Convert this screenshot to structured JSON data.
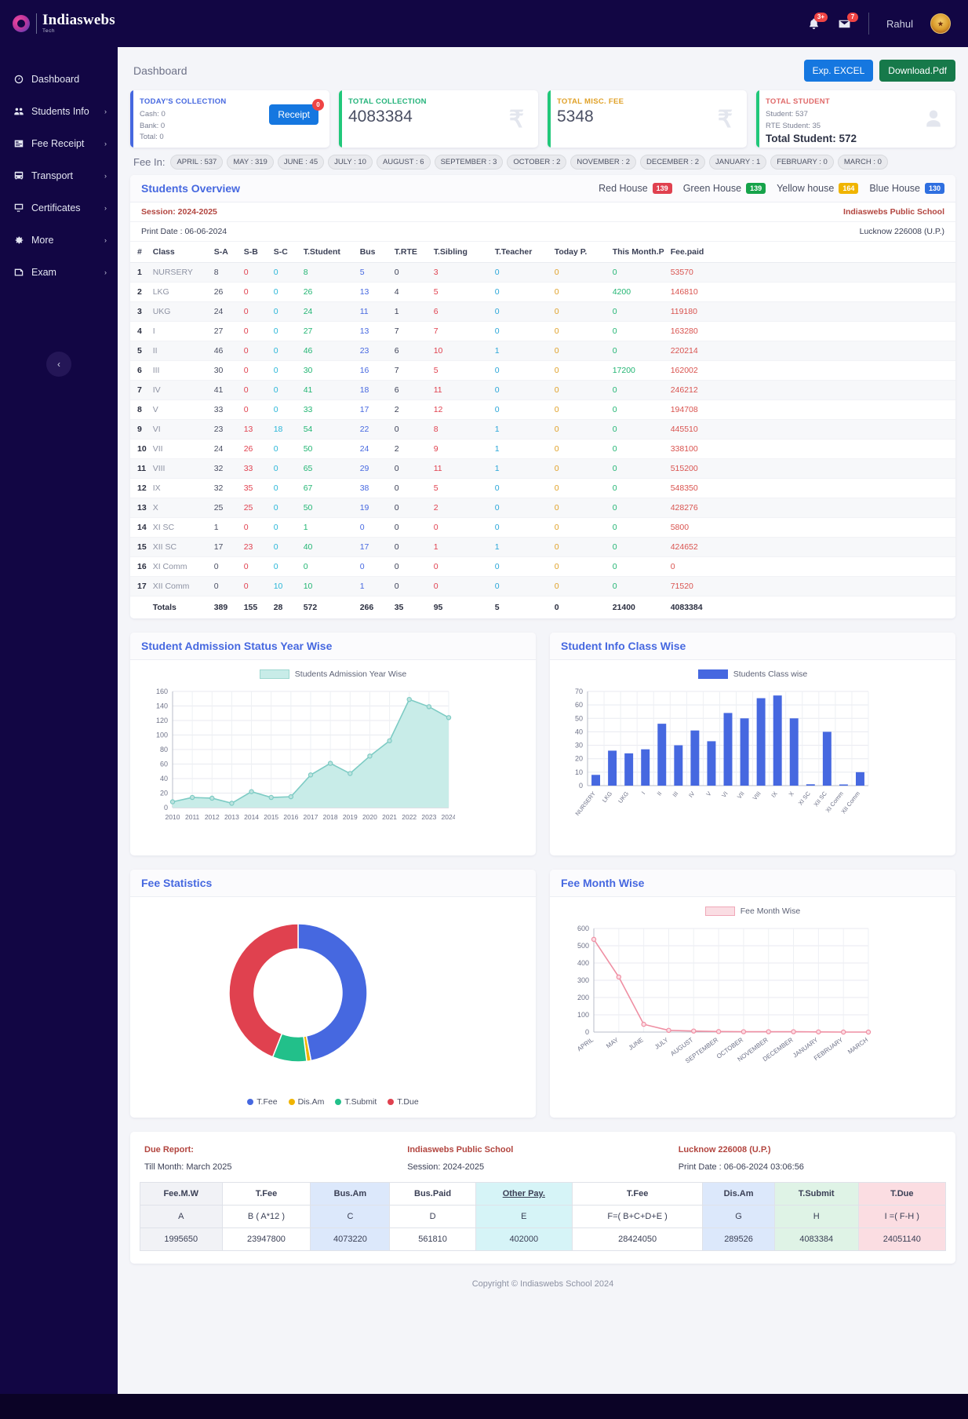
{
  "brand": {
    "name": "Indiaswebs",
    "sub": "Tech"
  },
  "sidebar": {
    "items": [
      {
        "label": "Dashboard",
        "icon": "gauge-icon",
        "chevron": ""
      },
      {
        "label": "Students Info",
        "icon": "users-icon",
        "chevron": "›"
      },
      {
        "label": "Fee Receipt",
        "icon": "receipt-icon",
        "chevron": "›"
      },
      {
        "label": "Transport",
        "icon": "bus-icon",
        "chevron": "›"
      },
      {
        "label": "Certificates",
        "icon": "certificate-icon",
        "chevron": "›"
      },
      {
        "label": "More",
        "icon": "gear-icon",
        "chevron": "›"
      },
      {
        "label": "Exam",
        "icon": "exam-icon",
        "chevron": "›"
      }
    ],
    "collapse_glyph": "‹"
  },
  "header": {
    "notifications_badge": "3+",
    "messages_badge": "7",
    "user_name": "Rahul",
    "avatar_text": "★"
  },
  "page": {
    "title": "Dashboard",
    "export_excel": "Exp. EXCEL",
    "download_pdf": "Download.Pdf"
  },
  "cards": [
    {
      "label": "TODAY'S COLLECTION",
      "lines": [
        "Cash: 0",
        "Bank: 0",
        "Total: 0"
      ],
      "button": "Receipt",
      "button_badge": "0"
    },
    {
      "label": "TOTAL COLLECTION",
      "value": "4083384",
      "icon": "rupee-icon"
    },
    {
      "label": "TOTAL MISC. FEE",
      "value": "5348",
      "icon": "rupee-icon"
    },
    {
      "label": "TOTAL STUDENT",
      "lines": [
        "Student: 537",
        "RTE Student: 35"
      ],
      "total": "Total Student: 572",
      "icon": "user-icon"
    }
  ],
  "fee_in": {
    "label": "Fee In:",
    "months": [
      "APRIL : 537",
      "MAY : 319",
      "JUNE : 45",
      "JULY : 10",
      "AUGUST : 6",
      "SEPTEMBER : 3",
      "OCTOBER : 2",
      "NOVEMBER : 2",
      "DECEMBER : 2",
      "JANUARY : 1",
      "FEBRUARY : 0",
      "MARCH : 0"
    ]
  },
  "overview": {
    "title": "Students Overview",
    "houses": [
      {
        "name": "Red House",
        "count": "139"
      },
      {
        "name": "Green House",
        "count": "139"
      },
      {
        "name": "Yellow house",
        "count": "164"
      },
      {
        "name": "Blue House",
        "count": "130"
      }
    ],
    "session": "Session: 2024-2025",
    "school": "Indiaswebs Public School",
    "print_date": "Print Date : 06-06-2024",
    "location": "Lucknow 226008 (U.P.)",
    "columns": [
      "#",
      "Class",
      "S-A",
      "S-B",
      "S-C",
      "T.Student",
      "Bus",
      "T.RTE",
      "T.Sibling",
      "T.Teacher",
      "Today P.",
      "This Month.P",
      "Fee.paid"
    ],
    "rows": [
      [
        "1",
        "NURSERY",
        "8",
        "0",
        "0",
        "8",
        "5",
        "0",
        "3",
        "0",
        "0",
        "0",
        "53570"
      ],
      [
        "2",
        "LKG",
        "26",
        "0",
        "0",
        "26",
        "13",
        "4",
        "5",
        "0",
        "0",
        "4200",
        "146810"
      ],
      [
        "3",
        "UKG",
        "24",
        "0",
        "0",
        "24",
        "11",
        "1",
        "6",
        "0",
        "0",
        "0",
        "119180"
      ],
      [
        "4",
        "I",
        "27",
        "0",
        "0",
        "27",
        "13",
        "7",
        "7",
        "0",
        "0",
        "0",
        "163280"
      ],
      [
        "5",
        "II",
        "46",
        "0",
        "0",
        "46",
        "23",
        "6",
        "10",
        "1",
        "0",
        "0",
        "220214"
      ],
      [
        "6",
        "III",
        "30",
        "0",
        "0",
        "30",
        "16",
        "7",
        "5",
        "0",
        "0",
        "17200",
        "162002"
      ],
      [
        "7",
        "IV",
        "41",
        "0",
        "0",
        "41",
        "18",
        "6",
        "11",
        "0",
        "0",
        "0",
        "246212"
      ],
      [
        "8",
        "V",
        "33",
        "0",
        "0",
        "33",
        "17",
        "2",
        "12",
        "0",
        "0",
        "0",
        "194708"
      ],
      [
        "9",
        "VI",
        "23",
        "13",
        "18",
        "54",
        "22",
        "0",
        "8",
        "1",
        "0",
        "0",
        "445510"
      ],
      [
        "10",
        "VII",
        "24",
        "26",
        "0",
        "50",
        "24",
        "2",
        "9",
        "1",
        "0",
        "0",
        "338100"
      ],
      [
        "11",
        "VIII",
        "32",
        "33",
        "0",
        "65",
        "29",
        "0",
        "11",
        "1",
        "0",
        "0",
        "515200"
      ],
      [
        "12",
        "IX",
        "32",
        "35",
        "0",
        "67",
        "38",
        "0",
        "5",
        "0",
        "0",
        "0",
        "548350"
      ],
      [
        "13",
        "X",
        "25",
        "25",
        "0",
        "50",
        "19",
        "0",
        "2",
        "0",
        "0",
        "0",
        "428276"
      ],
      [
        "14",
        "XI SC",
        "1",
        "0",
        "0",
        "1",
        "0",
        "0",
        "0",
        "0",
        "0",
        "0",
        "5800"
      ],
      [
        "15",
        "XII SC",
        "17",
        "23",
        "0",
        "40",
        "17",
        "0",
        "1",
        "1",
        "0",
        "0",
        "424652"
      ],
      [
        "16",
        "XI Comm",
        "0",
        "0",
        "0",
        "0",
        "0",
        "0",
        "0",
        "0",
        "0",
        "0",
        "0"
      ],
      [
        "17",
        "XII Comm",
        "0",
        "0",
        "10",
        "10",
        "1",
        "0",
        "0",
        "0",
        "0",
        "0",
        "71520"
      ]
    ],
    "totals": [
      "",
      "Totals",
      "389",
      "155",
      "28",
      "572",
      "266",
      "35",
      "95",
      "5",
      "0",
      "21400",
      "4083384"
    ]
  },
  "chart_data": [
    {
      "type": "area",
      "title": "Student Admission Status Year Wise",
      "legend": "Students Admission Year Wise",
      "legend_position": "top-center",
      "xlabel": "",
      "ylabel": "",
      "ylim": [
        0,
        160
      ],
      "yticks": [
        0,
        20,
        40,
        60,
        80,
        100,
        120,
        140,
        160
      ],
      "grid": true,
      "x": [
        "2010",
        "2011",
        "2012",
        "2013",
        "2014",
        "2015",
        "2016",
        "2017",
        "2018",
        "2019",
        "2020",
        "2021",
        "2022",
        "2023",
        "2024"
      ],
      "values": [
        8,
        14,
        13,
        6,
        22,
        14,
        15,
        45,
        61,
        47,
        71,
        92,
        149,
        139,
        124
      ],
      "color": "#7dcbc4",
      "fill": "#c8ece8"
    },
    {
      "type": "bar",
      "title": "Student Info Class Wise",
      "legend": "Students Class wise",
      "legend_position": "top-center",
      "xlabel": "",
      "ylabel": "",
      "ylim": [
        0,
        70
      ],
      "yticks": [
        0,
        10,
        20,
        30,
        40,
        50,
        60,
        70
      ],
      "grid": true,
      "categories": [
        "NURSERY",
        "LKG",
        "UKG",
        "I",
        "II",
        "III",
        "IV",
        "V",
        "VI",
        "VII",
        "VIII",
        "IX",
        "X",
        "XI SC",
        "XII SC",
        "XI Comm",
        "XII Comm"
      ],
      "values": [
        8,
        26,
        24,
        27,
        46,
        30,
        41,
        33,
        54,
        50,
        65,
        67,
        50,
        1,
        40,
        0,
        10
      ],
      "color": "#4668e0"
    },
    {
      "type": "pie",
      "title": "Fee Statistics",
      "legend_position": "bottom-center",
      "labels": [
        "T.Fee",
        "Dis.Am",
        "T.Submit",
        "T.Due"
      ],
      "colors": [
        "#4668e0",
        "#f0b400",
        "#22c08a",
        "#e0414f"
      ],
      "values": [
        47,
        1,
        8,
        44
      ]
    },
    {
      "type": "line",
      "title": "Fee Month Wise",
      "legend": "Fee Month Wise",
      "legend_position": "top-center",
      "xlabel": "",
      "ylabel": "",
      "ylim": [
        0,
        600
      ],
      "yticks": [
        0,
        100,
        200,
        300,
        400,
        500,
        600
      ],
      "grid": true,
      "x": [
        "APRIL",
        "MAY",
        "JUNE",
        "JULY",
        "AUGUST",
        "SEPTEMBER",
        "OCTOBER",
        "NOVEMBER",
        "DECEMBER",
        "JANUARY",
        "FEBRUARY",
        "MARCH"
      ],
      "values": [
        537,
        319,
        45,
        10,
        6,
        3,
        2,
        2,
        2,
        1,
        0,
        0
      ],
      "color": "#ef8fa3"
    }
  ],
  "due_report": {
    "label": "Due Report:",
    "school": "Indiaswebs Public School",
    "location": "Lucknow 226008 (U.P.)",
    "till_month": "Till Month: March 2025",
    "session": "Session: 2024-2025",
    "print_date": "Print Date : 06-06-2024 03:06:56",
    "headers": [
      "Fee.M.W",
      "T.Fee",
      "Bus.Am",
      "Bus.Paid",
      "Other Pay.",
      "T.Fee",
      "Dis.Am",
      "T.Submit",
      "T.Due"
    ],
    "formulas": [
      "A",
      "B ( A*12 )",
      "C",
      "D",
      "E",
      "F=( B+C+D+E )",
      "G",
      "H",
      "I =( F-H )"
    ],
    "values": [
      "1995650",
      "23947800",
      "4073220",
      "561810",
      "402000",
      "28424050",
      "289526",
      "4083384",
      "24051140"
    ]
  },
  "footer": {
    "copyright": "Copyright © Indiaswebs School 2024"
  }
}
